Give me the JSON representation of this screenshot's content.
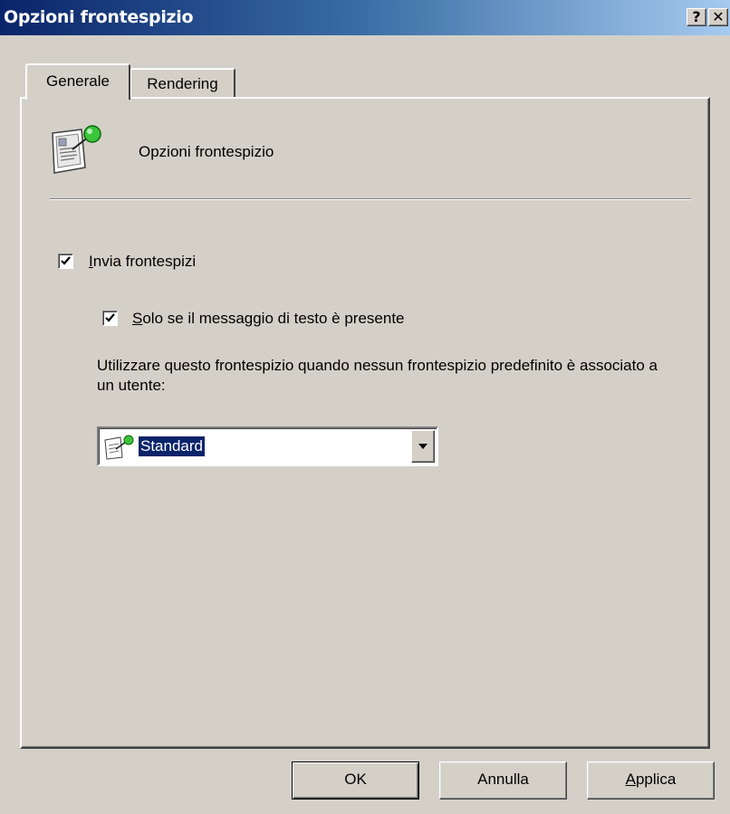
{
  "window": {
    "title": "Opzioni frontespizio",
    "help_button": "?",
    "close_button": "✕"
  },
  "tabs": [
    {
      "label": "Generale",
      "active": true
    },
    {
      "label": "Rendering",
      "active": false
    }
  ],
  "header": {
    "icon": "cover-page-icon",
    "text": "Opzioni frontespizio"
  },
  "options": {
    "send_cover_pages": {
      "checked": true,
      "mnemonic": "I",
      "label_rest": "nvia frontespizi"
    },
    "only_if_text": {
      "checked": true,
      "mnemonic": "S",
      "label_rest": "olo se il messaggio di testo è presente"
    }
  },
  "description": "Utilizzare questo frontespizio quando nessun frontespizio predefinito è associato a un utente:",
  "cover_select": {
    "icon": "cover-page-icon",
    "value": "Standard"
  },
  "buttons": {
    "ok": "OK",
    "cancel": "Annulla",
    "apply_mnemonic": "A",
    "apply_rest": "pplica"
  },
  "colors": {
    "title_bar_start": "#0a246a",
    "title_bar_end": "#a6caf0",
    "face": "#d4d0c8",
    "selection": "#0a246a"
  }
}
